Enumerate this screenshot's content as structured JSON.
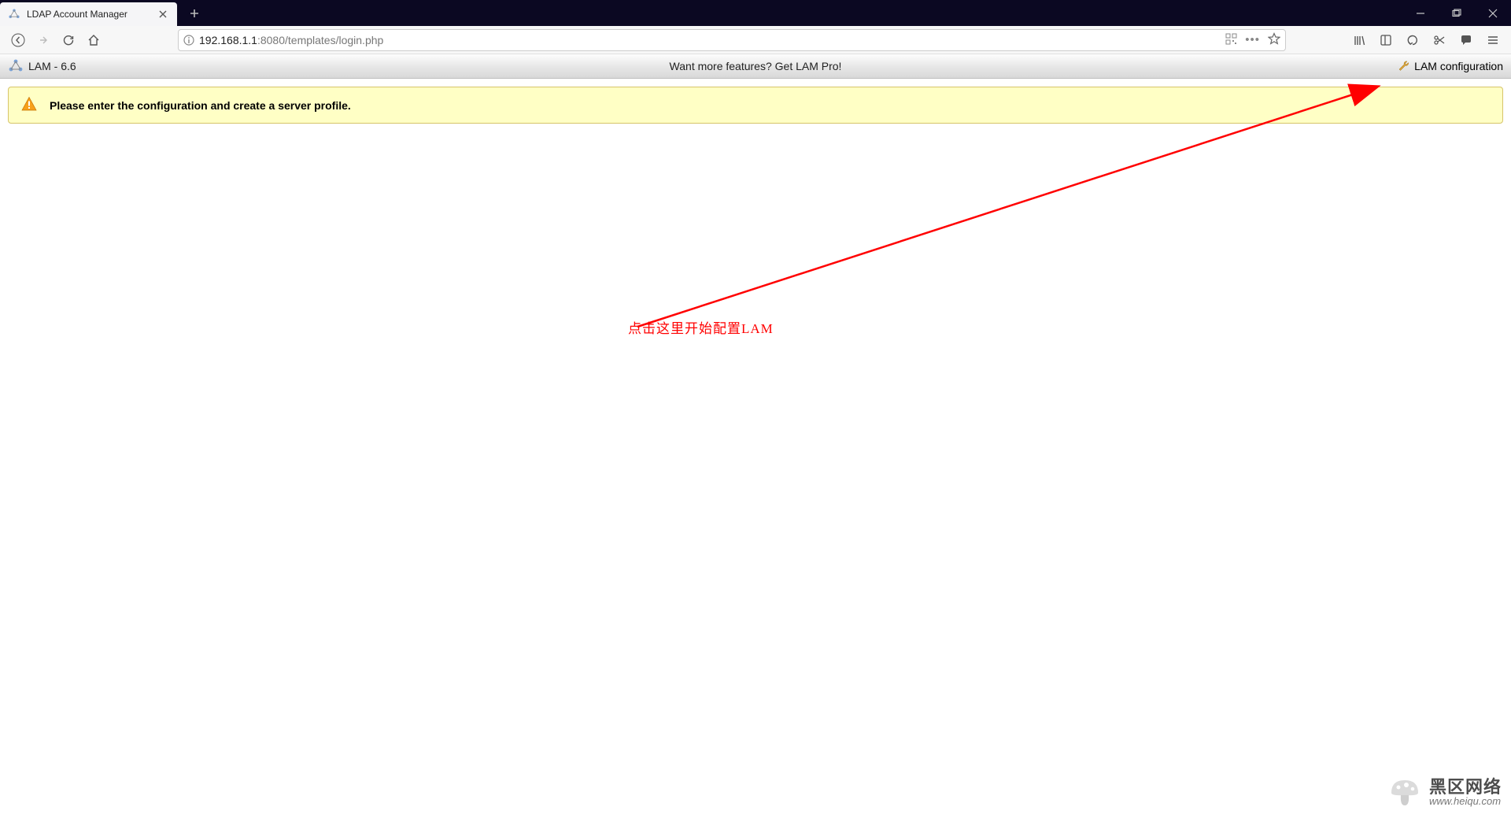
{
  "browser": {
    "tab_title": "LDAP Account Manager",
    "url_host": "192.168.1.1",
    "url_port_path": ":8080/templates/login.php"
  },
  "lam": {
    "version_label": "LAM - 6.6",
    "center_text": "Want more features? Get LAM Pro!",
    "config_link": "LAM configuration"
  },
  "alert": {
    "message": "Please enter the configuration and create a server profile."
  },
  "annotation": {
    "text": "点击这里开始配置LAM"
  },
  "watermark": {
    "cn": "黑区网络",
    "url": "www.heiqu.com"
  }
}
